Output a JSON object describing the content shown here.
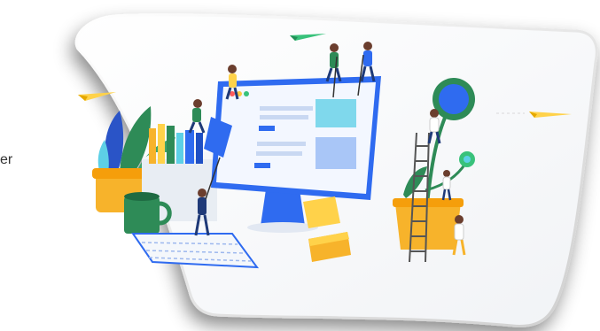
{
  "partial_text": "er",
  "colors": {
    "monitor_blue": "#2F6BF0",
    "screen_light": "#E9F1FF",
    "accent_cyan": "#5DD0E6",
    "plant_green": "#2E8B57",
    "pot_orange": "#F7B32B",
    "card_shadow": "#8D8D8D",
    "paper_plane_yellow": "#FFD24A",
    "paper_plane_green": "#39C27B"
  },
  "icons": {
    "browser_dots": [
      "red-dot",
      "yellow-dot",
      "green-dot"
    ]
  }
}
